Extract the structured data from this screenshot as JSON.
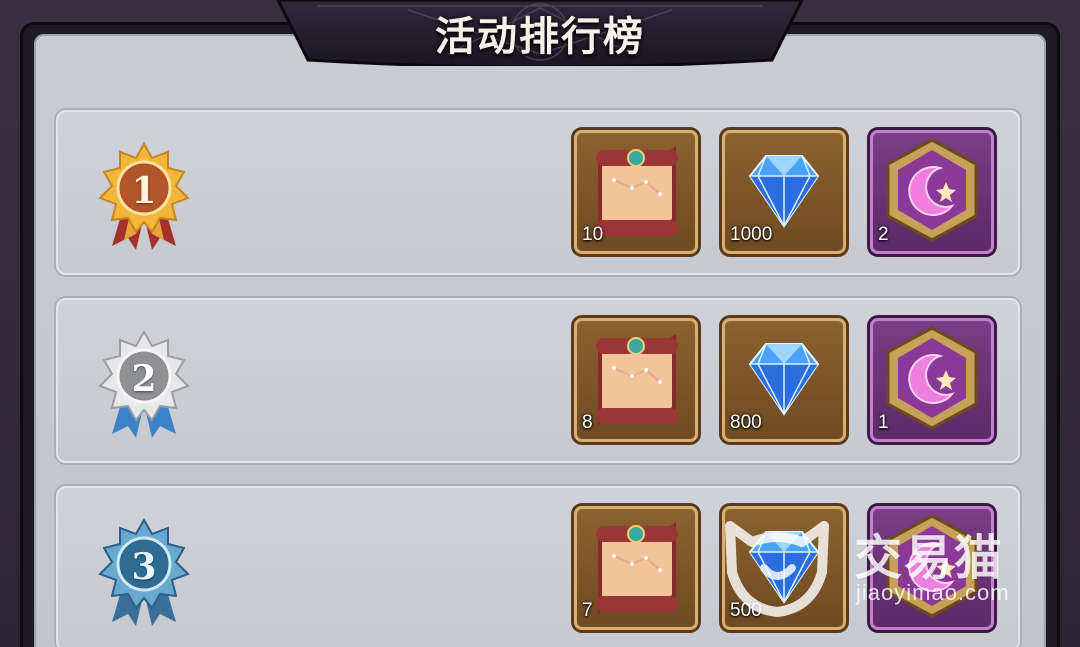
{
  "header": {
    "title": "活动排行榜"
  },
  "ranks": [
    {
      "rank": "1",
      "rewards": [
        {
          "icon": "scroll-icon",
          "qty": "10"
        },
        {
          "icon": "diamond-icon",
          "qty": "1000"
        },
        {
          "icon": "moon-badge-icon",
          "qty": "2"
        }
      ]
    },
    {
      "rank": "2",
      "rewards": [
        {
          "icon": "scroll-icon",
          "qty": "8"
        },
        {
          "icon": "diamond-icon",
          "qty": "800"
        },
        {
          "icon": "moon-badge-icon",
          "qty": "1"
        }
      ]
    },
    {
      "rank": "3",
      "rewards": [
        {
          "icon": "scroll-icon",
          "qty": "7"
        },
        {
          "icon": "diamond-icon",
          "qty": "500"
        },
        {
          "icon": "moon-badge-icon",
          "qty": ""
        }
      ]
    }
  ],
  "watermark": {
    "name_cn": "交易猫",
    "domain": "jiaoyimao.com"
  },
  "colors": {
    "gold": "#c9862a",
    "silver": "#bfc2c6",
    "bronze_blue": "#3b7fa6",
    "item_brown": "#7a5428",
    "item_purple": "#6a3276"
  }
}
